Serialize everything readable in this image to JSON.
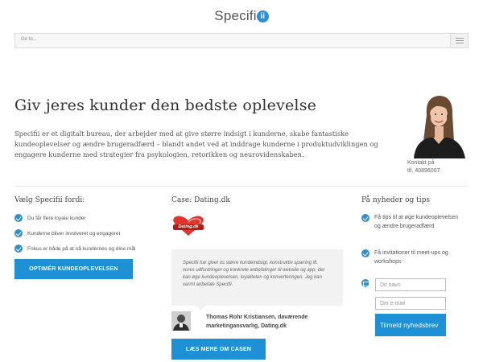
{
  "header": {
    "logo_text": "Specifi",
    "logo_badge": "ii"
  },
  "nav": {
    "placeholder": "Go to...",
    "menu_icon": "hamburger-menu-icon"
  },
  "hero": {
    "title": "Giv jeres kunder den bedste oplevelse",
    "text": "Specifii er et digitalt bureau, der arbejder med at give større indsigt i kunderne, skabe fantastiske kundeoplevelser og ændre brugeradfærd – blandt andet ved at inddrage kunderne i produktudviklingen og engagere kunderne med strategier fra psykologien, retorikken og neurovidenskaben.",
    "contact_line1": "Kontakt på",
    "contact_line2": "tlf. 40896007"
  },
  "left_column": {
    "title": "Vælg Specifii fordi:",
    "items": [
      "Du får flere loyale kunder",
      "Kunderne bliver involveret og engageret",
      "Fokus er både på at nå kundernes og dine mål"
    ],
    "button": "OPTIMÉR KUNDEOPLEVELSEN"
  },
  "middle_column": {
    "title": "Case: Dating.dk",
    "logo_text": "Dating.dk",
    "quote": "Specifii har givet os større kundeindsigt, konstruktiv sparring ift. vores udfordringer og konkrete anbefalinger til website og app, der kan øge kundeoplevelsen, loyaliteten og konverteringen. Jeg kan varmt anbefale Specifii.",
    "author_line1": "Thomas Rohr Kristiansen, daværende",
    "author_line2": "marketingansvarlig, Dating.dk",
    "button": "LÆS MERE OM CASEN"
  },
  "right_column": {
    "title": "På nyheder og tips",
    "items": [
      "Få tips til at øge kundeoplevelsen og ændre brugeradfærd",
      "Få invitationer til meet-ups og workshops"
    ],
    "name_placeholder": "Dit navn",
    "email_placeholder": "Din e-mail",
    "button": "Tilmeld nyhedsbrev"
  },
  "colors": {
    "accent": "#1e90d6",
    "text": "#333333",
    "muted": "#666666"
  }
}
